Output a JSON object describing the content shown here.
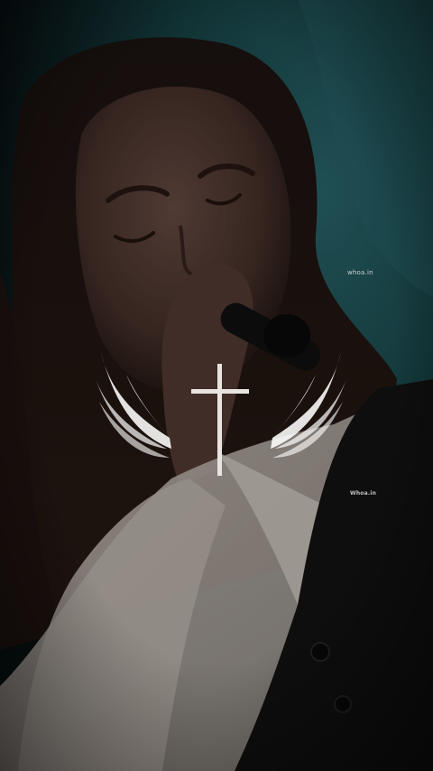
{
  "watermarks": {
    "top": "whoa.in",
    "bottom": "Whoa.in"
  },
  "overlay": {
    "icon": "cross-with-wings-icon",
    "cross_color": "#e9e4e0",
    "wing_color": "#ffffff"
  },
  "colors": {
    "background_teal": "#1f5a5f",
    "background_dark": "#0d1a1c",
    "shirt": "#d9d0c8",
    "vest": "#141414"
  }
}
